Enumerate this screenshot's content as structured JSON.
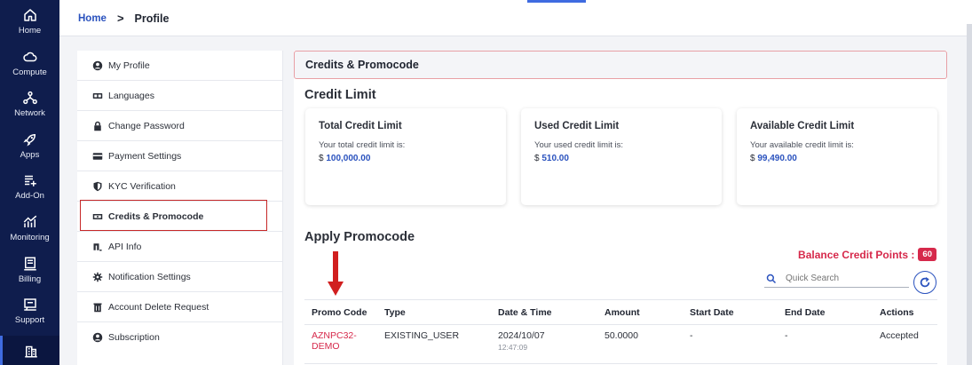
{
  "nav": {
    "items": [
      {
        "label": "Home",
        "icon": "home-icon"
      },
      {
        "label": "Compute",
        "icon": "cloud-icon"
      },
      {
        "label": "Network",
        "icon": "network-icon"
      },
      {
        "label": "Apps",
        "icon": "rocket-icon"
      },
      {
        "label": "Add-On",
        "icon": "add-list-icon"
      },
      {
        "label": "Monitoring",
        "icon": "monitoring-icon"
      },
      {
        "label": "Billing",
        "icon": "billing-icon"
      },
      {
        "label": "Support",
        "icon": "support-icon"
      }
    ]
  },
  "breadcrumb": {
    "home": "Home",
    "separator": ">",
    "current": "Profile"
  },
  "settings_menu": {
    "items": [
      {
        "label": "My Profile",
        "icon": "user-circle-icon"
      },
      {
        "label": "Languages",
        "icon": "language-icon"
      },
      {
        "label": "Change Password",
        "icon": "lock-icon"
      },
      {
        "label": "Payment Settings",
        "icon": "credit-card-icon"
      },
      {
        "label": "KYC Verification",
        "icon": "shield-icon"
      },
      {
        "label": "Credits & Promocode",
        "icon": "money-icon"
      },
      {
        "label": "API Info",
        "icon": "api-icon"
      },
      {
        "label": "Notification Settings",
        "icon": "gear-icon"
      },
      {
        "label": "Account Delete Request",
        "icon": "trash-icon"
      },
      {
        "label": "Subscription",
        "icon": "user-circle-icon"
      }
    ],
    "selected": "Credits & Promocode"
  },
  "panel": {
    "header": "Credits & Promocode",
    "credit_limit_title": "Credit Limit",
    "cards": [
      {
        "title": "Total Credit Limit",
        "desc": "Your total credit limit is:",
        "currency": "$",
        "value": "100,000.00"
      },
      {
        "title": "Used Credit Limit",
        "desc": "Your used credit limit is:",
        "currency": "$",
        "value": "510.00"
      },
      {
        "title": "Available Credit Limit",
        "desc": "Your available credit limit is:",
        "currency": "$",
        "value": "99,490.00"
      }
    ],
    "apply_title": "Apply Promocode",
    "balance_label": "Balance Credit Points :",
    "balance_value": "60",
    "search_placeholder": "Quick Search"
  },
  "table": {
    "headers": [
      "Promo Code",
      "Type",
      "Date & Time",
      "Amount",
      "Start Date",
      "End Date",
      "Actions"
    ],
    "rows": [
      {
        "code": "AZNPC32-DEMO",
        "type": "EXISTING_USER",
        "date": "2024/10/07",
        "time": "12:47:09",
        "amount": "50.0000",
        "start": "-",
        "end": "-",
        "action": "Accepted"
      }
    ]
  },
  "colors": {
    "nav_bg": "#0f1d4d",
    "accent": "#2a52be",
    "danger": "#d6294b"
  }
}
